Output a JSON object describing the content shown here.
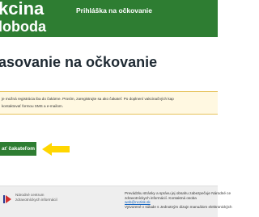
{
  "header": {
    "brand_line1": "kcina",
    "brand_line2": "loboda",
    "login_link": "Prihláška na očkovanie"
  },
  "main": {
    "title": "asovanie na očkovanie",
    "notice_line1": "je možná registrácia iba do čakárne. Prosím, zaregistrujte sa ako čakateľ. Po doplnení vakcinačných kap",
    "notice_line2": "kontaktovať formou SMS a e-mailom.",
    "cta_label": "ať čakateľom"
  },
  "footer": {
    "org_line1": "Národné centrum",
    "org_line2": "zdravotníckych informácií",
    "text_line1": "Prevádzku stránky a správu jej obsahu zabezpečuje Národné ce",
    "text_line2": "zdravotníckych informácií. Kontaktná osoba ",
    "text_link": "web@nczisk.sk",
    "text_line3": "Vytvorené v súlade s Jednotným dizajn manuálom elektronických"
  },
  "colors": {
    "brand_green": "#2e7d32",
    "notice_bg": "#fff8e1",
    "notice_border": "#e6c35c",
    "arrow": "#ffd600"
  },
  "icons": {
    "arrow": "arrow-left-icon",
    "logo": "nczi-logo-icon"
  }
}
